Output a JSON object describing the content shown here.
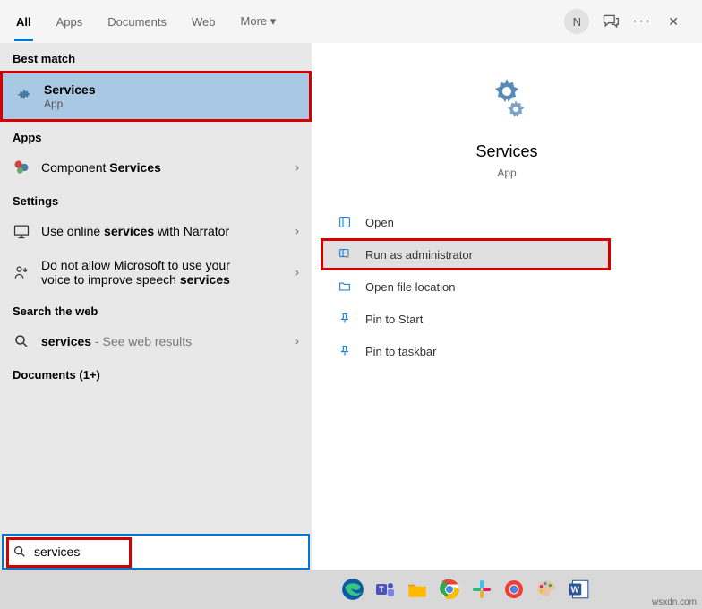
{
  "tabs": [
    "All",
    "Apps",
    "Documents",
    "Web",
    "More ▾"
  ],
  "avatar_letter": "N",
  "sections": {
    "best_match_label": "Best match",
    "apps_label": "Apps",
    "settings_label": "Settings",
    "web_label": "Search the web",
    "docs_label": "Documents (1+)"
  },
  "best_match": {
    "title": "Services",
    "sub": "App"
  },
  "apps_item": {
    "prefix": "Component ",
    "bold": "Services"
  },
  "settings1": {
    "prefix": "Use online ",
    "bold": "services",
    "suffix": " with Narrator"
  },
  "settings2": {
    "line1_prefix": "Do not allow Microsoft to use your",
    "line2_prefix": "voice to improve speech ",
    "bold": "services"
  },
  "web_item": {
    "bold": "services",
    "suffix": " - See web results"
  },
  "hero": {
    "title": "Services",
    "sub": "App"
  },
  "actions": [
    "Open",
    "Run as administrator",
    "Open file location",
    "Pin to Start",
    "Pin to taskbar"
  ],
  "search_value": "services",
  "watermark": "wsxdn.com"
}
